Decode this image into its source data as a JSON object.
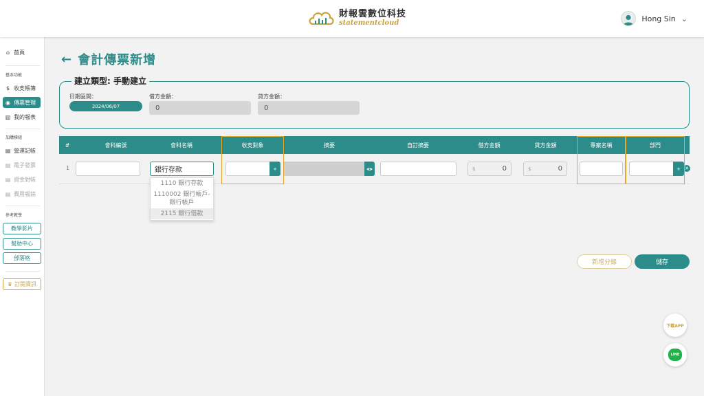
{
  "header": {
    "logo_cn": "財報雲數位科技",
    "logo_en": "statementcloud",
    "user_name": "Hong Sin",
    "user_chevron": "⌄"
  },
  "sidebar": {
    "home": {
      "label": "首頁",
      "icon": "home-icon"
    },
    "section_basic": "基本功能",
    "basic_items": [
      {
        "label": "收支帳簿",
        "icon": "ledger-icon"
      },
      {
        "label": "傳票管理",
        "icon": "voucher-icon",
        "active": true
      },
      {
        "label": "我的報表",
        "icon": "report-icon"
      }
    ],
    "section_plugins": "加購模組",
    "plugin_items": [
      {
        "label": "營運記帳",
        "icon": "bookkeeping-icon"
      },
      {
        "label": "電子發票",
        "icon": "invoice-icon",
        "disabled": true
      },
      {
        "label": "資金對帳",
        "icon": "reconcile-icon",
        "disabled": true
      },
      {
        "label": "費用報銷",
        "icon": "expense-icon",
        "disabled": true
      }
    ],
    "section_reference": "參考教學",
    "ref_buttons": [
      "教學影片",
      "幫助中心",
      "部落格"
    ],
    "subscribe": "訂閱資訊"
  },
  "page": {
    "back_arrow": "←",
    "title": "會計傳票新增",
    "legend": "建立類型: 手動建立",
    "date_label": "日期區間：",
    "date_value": "2024/06/07",
    "debit_label": "借方金額：",
    "debit_value": "0",
    "credit_label": "貸方金額：",
    "credit_value": "0"
  },
  "table": {
    "headers": [
      "#",
      "會科編號",
      "會科名稱",
      "收支對象",
      "摘要",
      "自訂摘要",
      "借方金額",
      "貸方金額",
      "專案名稱",
      "部門"
    ],
    "row": {
      "num": "1",
      "account_code": "",
      "account_name": "銀行存款",
      "counterparty": "",
      "custom_summary": "",
      "debit": "0",
      "credit": "0",
      "project": "",
      "department": "",
      "currency": "$",
      "add_symbol": "+",
      "remove_symbol": "✕"
    },
    "dropdown_options": [
      "1110 銀行存款",
      "1110002 銀行帳戶-銀行帳戶",
      "2115 銀行借款"
    ]
  },
  "actions": {
    "add_entry": "新增分錄",
    "save": "儲存"
  },
  "floating": {
    "download_app": "下載APP",
    "line": "LINE"
  },
  "colors": {
    "primary": "#2c8c8a",
    "gold": "#c8a23a",
    "highlight": "#e4a728"
  }
}
